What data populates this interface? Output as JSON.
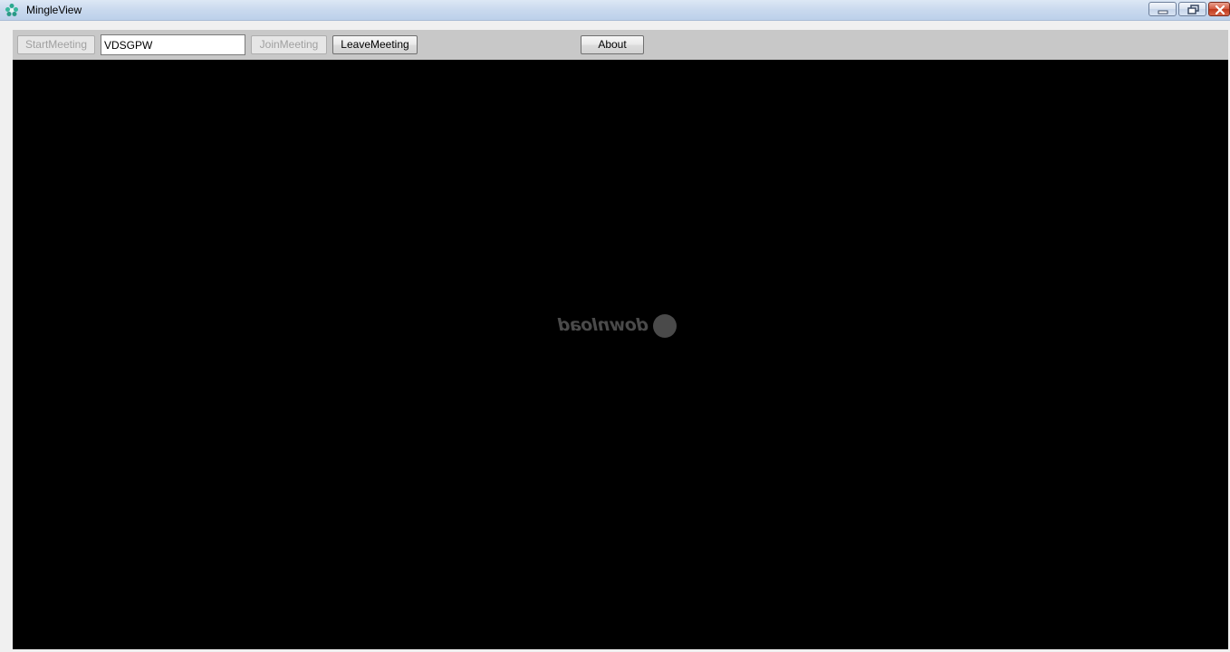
{
  "window": {
    "title": "MingleView",
    "icons": {
      "app": "mingleview-app-icon",
      "minimize": "minimize-icon",
      "restore": "restore-icon",
      "close": "close-icon"
    }
  },
  "toolbar": {
    "start_label": "StartMeeting",
    "meeting_id_value": "VDSGPW",
    "join_label": "JoinMeeting",
    "leave_label": "LeaveMeeting",
    "about_label": "About"
  },
  "viewer": {
    "watermark_text": "download"
  },
  "colors": {
    "viewer_background": "#000000",
    "toolbar_background": "#c8c8c8",
    "close_button": "#c0381c"
  }
}
